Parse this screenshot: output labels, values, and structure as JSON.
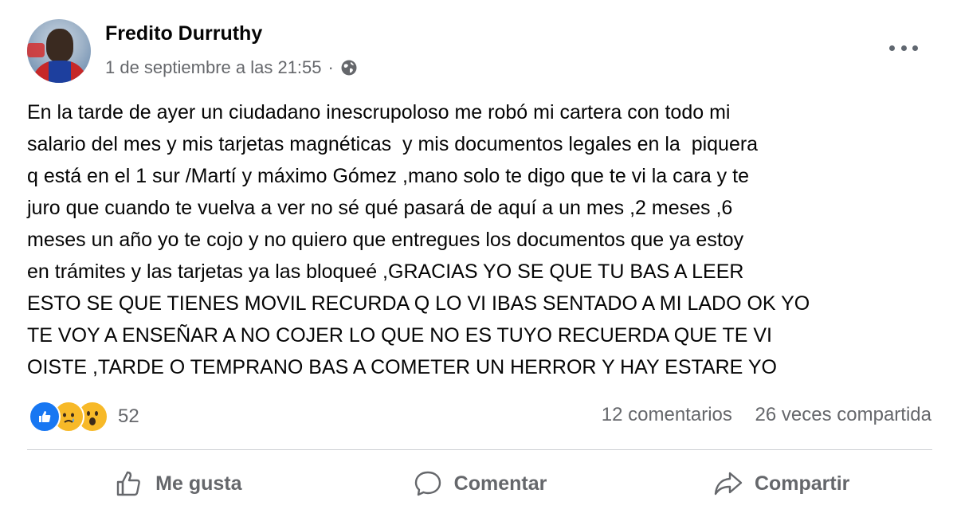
{
  "post": {
    "author": "Fredito Durruthy",
    "timestamp": "1 de septiembre a las 21:55",
    "separator": "·",
    "audience_icon": "globe-icon",
    "more_icon": "more-options-icon",
    "body_lines": [
      "En la tarde de ayer un ciudadano inescrupoloso me robó mi cartera con todo mi",
      "salario del mes y mis tarjetas magnéticas  y mis documentos legales en la  piquera",
      "q está en el 1 sur /Martí y máximo Gómez ,mano solo te digo que te vi la cara y te",
      "juro que cuando te vuelva a ver no sé qué pasará de aquí a un mes ,2 meses ,6",
      "meses un año yo te cojo y no quiero que entregues los documentos que ya estoy",
      "en trámites y las tarjetas ya las bloqueé ,GRACIAS YO SE QUE TU BAS A LEER",
      "ESTO SE QUE TIENES MOVIL RECURDA Q LO VI IBAS SENTADO A MI LADO OK YO",
      "TE VOY A ENSEÑAR A NO COJER LO QUE NO ES TUYO RECUERDA QUE TE VI",
      "OISTE ,TARDE O TEMPRANO BAS A COMETER UN HERROR Y HAY ESTARE YO"
    ]
  },
  "reactions": {
    "icons": [
      "like-reaction-icon",
      "sad-reaction-icon",
      "wow-reaction-icon"
    ],
    "count": "52"
  },
  "stats": {
    "comments": "12 comentarios",
    "shares": "26 veces compartida"
  },
  "actions": {
    "like": "Me gusta",
    "comment": "Comentar",
    "share": "Compartir"
  },
  "colors": {
    "text": "#050505",
    "secondary": "#65676b",
    "like_blue": "#1877f2",
    "reaction_yellow": "#f7b928",
    "divider": "#ced0d4"
  }
}
